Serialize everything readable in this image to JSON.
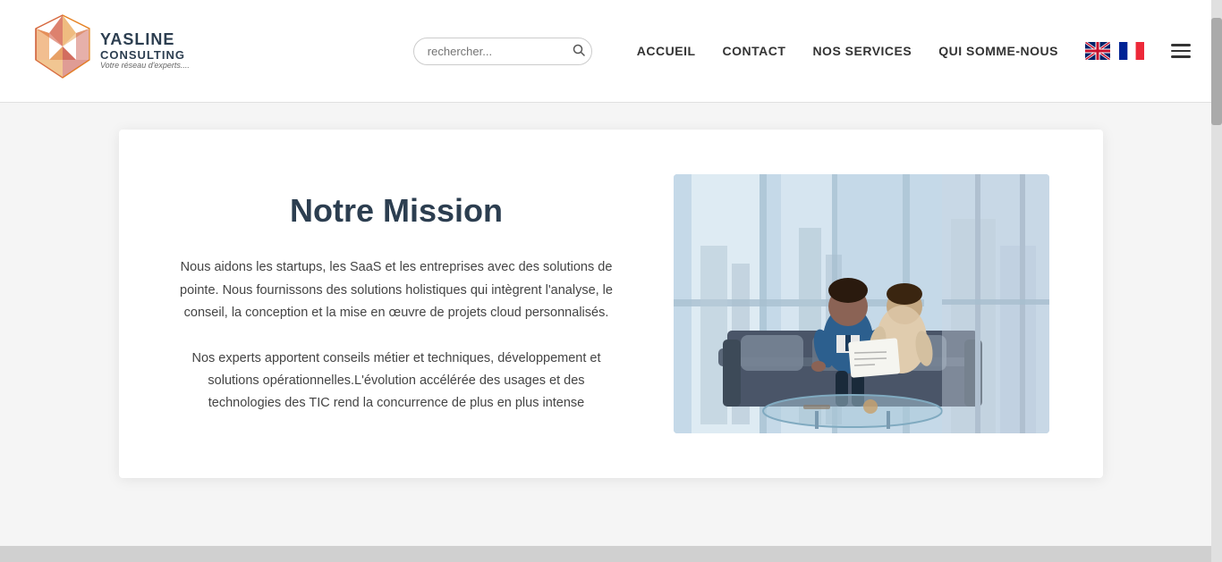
{
  "header": {
    "logo": {
      "name_line1": "YASLINE",
      "name_line2": "CONSULTING",
      "tagline": "Votre réseau d'experts...."
    },
    "search": {
      "placeholder": "rechercher...",
      "button_label": "🔍"
    },
    "nav": {
      "items": [
        {
          "label": "ACCUEIL",
          "id": "accueil"
        },
        {
          "label": "CONTACT",
          "id": "contact"
        },
        {
          "label": "NOS SERVICES",
          "id": "nos-services"
        },
        {
          "label": "QUI SOMME-NOUS",
          "id": "qui-somme-nous"
        }
      ]
    },
    "flags": [
      {
        "id": "en",
        "label": "English"
      },
      {
        "id": "fr",
        "label": "Français"
      }
    ],
    "menu_icon": "☰"
  },
  "main": {
    "card": {
      "title": "Notre Mission",
      "paragraph1": "Nous aidons les startups, les SaaS et les entreprises avec des solutions de pointe.  Nous fournissons des solutions holistiques qui intègrent l'analyse, le conseil, la conception et la mise en œuvre de projets cloud personnalisés.",
      "paragraph2": "Nos experts apportent conseils métier et techniques, développement et solutions opérationnelles.L'évolution accélérée des usages et des technologies des TIC rend la concurrence de plus en plus intense"
    }
  }
}
